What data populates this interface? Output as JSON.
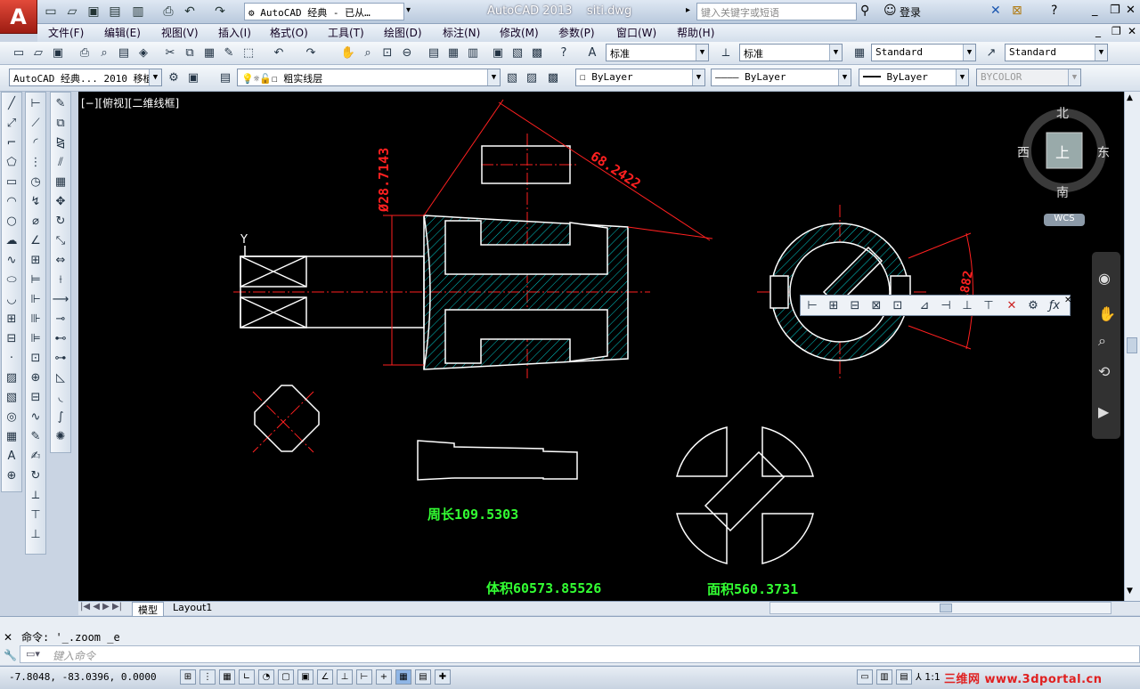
{
  "title": {
    "app": "AutoCAD 2013",
    "file": "siti.dwg",
    "workspace": "AutoCAD 经典 - 已从…",
    "search_placeholder": "键入关键字或短语",
    "login": "登录"
  },
  "menu": [
    "文件(F)",
    "编辑(E)",
    "视图(V)",
    "插入(I)",
    "格式(O)",
    "工具(T)",
    "绘图(D)",
    "标注(N)",
    "修改(M)",
    "参数(P)",
    "窗口(W)",
    "帮助(H)"
  ],
  "styles": {
    "text_style": "标准",
    "dim_style": "标准",
    "table_style": "Standard",
    "mleader_style": "Standard"
  },
  "layers": {
    "workspace2": "AutoCAD 经典... 2010 移植",
    "current_layer": "粗实线层",
    "color": "ByLayer",
    "linetype": "ByLayer",
    "lineweight": "ByLayer",
    "plotstyle": "BYCOLOR"
  },
  "viewport_label": "[−][俯视][二维线框]",
  "viewcube": {
    "north": "北",
    "south": "南",
    "east": "东",
    "west": "西",
    "top": "上",
    "wcs": "WCS"
  },
  "drawing": {
    "dim_diameter": "Ø28.7143",
    "dim_aligned": "68.2422",
    "dim_right": "1882",
    "ucs_label": "Y",
    "perimeter": "周长109.5303",
    "volume": "体积60573.85526",
    "area": "面积560.3731"
  },
  "tabs": {
    "model": "模型",
    "layout": "Layout1"
  },
  "command": {
    "history": "命令: '_.zoom _e",
    "prompt_placeholder": "键入命令"
  },
  "status": {
    "coords": "-7.8048, -83.0396, 0.0000",
    "scale": "1:1",
    "watermark": "三维网 www.3dportal.cn"
  },
  "colors": {
    "canvas": "#000000",
    "hatch": "#00c8c8",
    "dim": "#ff2020",
    "annot": "#33ff33",
    "geometry": "#ffffff"
  }
}
